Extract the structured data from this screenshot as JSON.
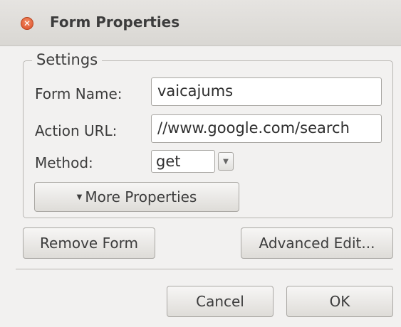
{
  "window": {
    "title": "Form Properties",
    "close_symbol": "✕"
  },
  "settings": {
    "legend": "Settings",
    "form_name_label": "Form Name:",
    "form_name_value": "vaicajums",
    "action_url_label": "Action URL:",
    "action_url_value": "//www.google.com/search",
    "method_label": "Method:",
    "method_value": "get",
    "more_properties_label": "More Properties"
  },
  "buttons": {
    "remove_form": "Remove Form",
    "advanced_edit": "Advanced Edit...",
    "cancel": "Cancel",
    "ok": "OK"
  }
}
